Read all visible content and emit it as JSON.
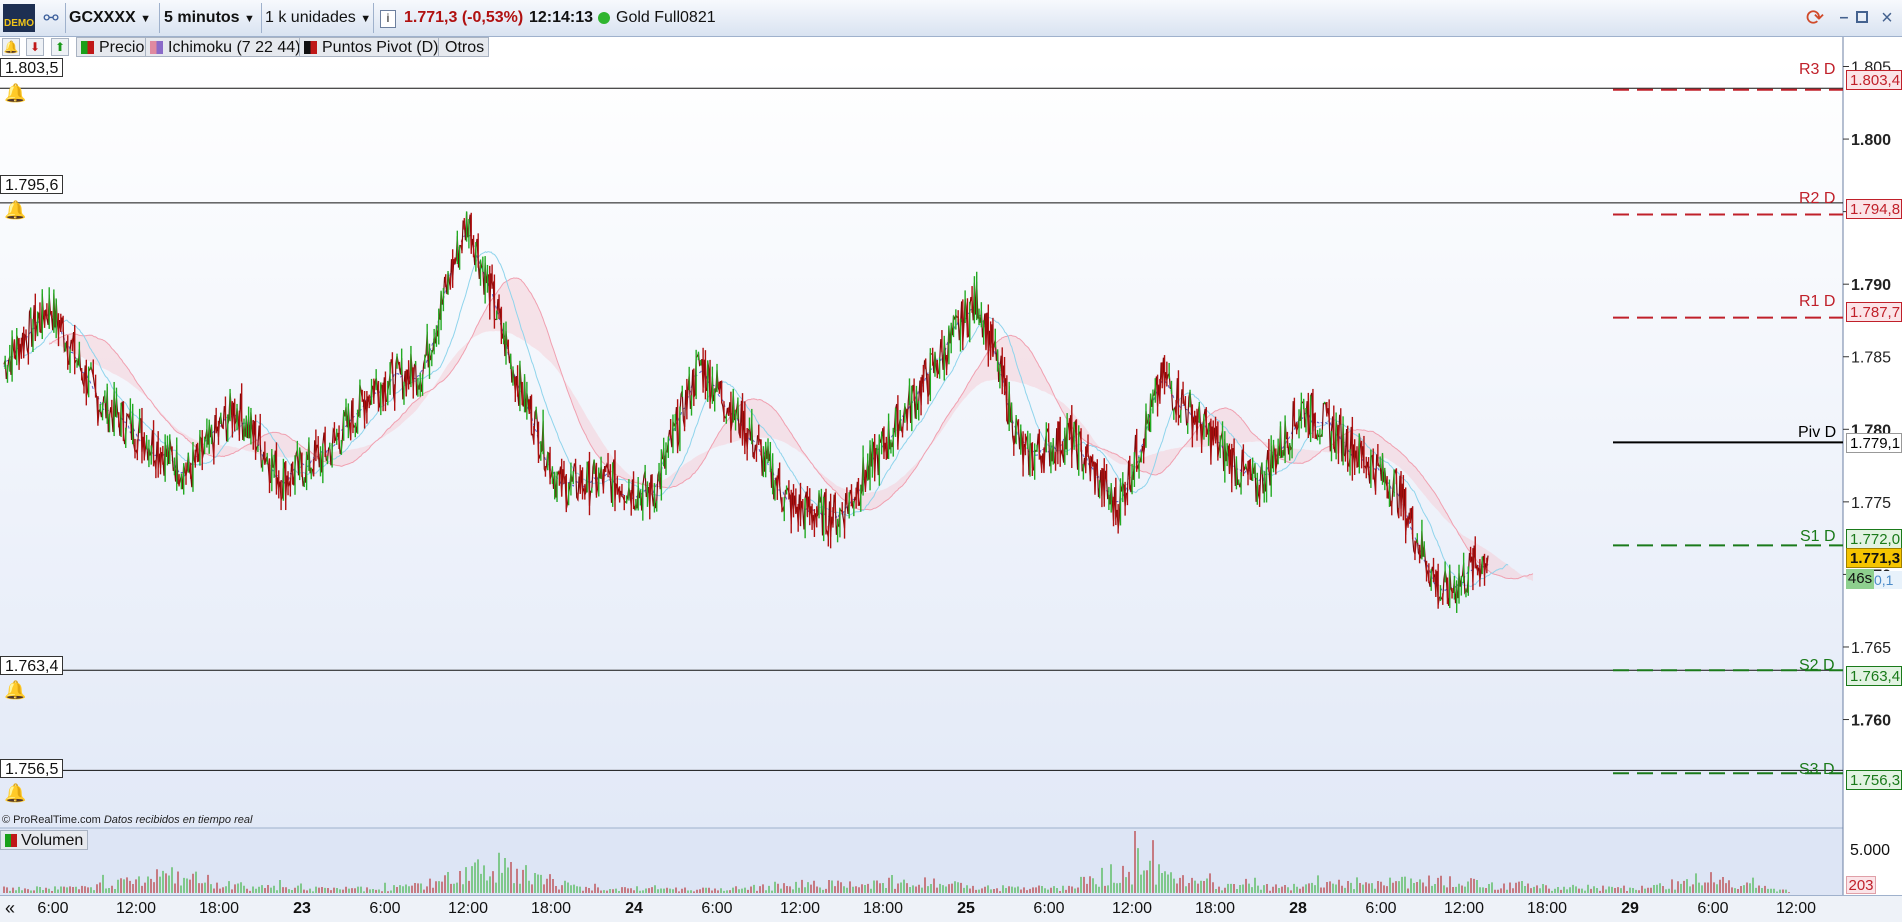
{
  "toolbar": {
    "demo_badge": "DEMO",
    "instrument": "GCXXXX",
    "timeframe": "5 minutos",
    "units": "1 k unidades",
    "price_change": "1.771,3 (-0,53%)",
    "time": "12:14:13",
    "contract": "Gold Full0821"
  },
  "subbar": {
    "pills": [
      "Precio",
      "Ichimoku (7 22 44)",
      "Puntos Pivot (D)",
      "Otros"
    ]
  },
  "alarm_levels": [
    "1.803,5",
    "1.795,6",
    "1.763,4",
    "1.756,5"
  ],
  "pivots": [
    {
      "label": "R3 D",
      "value": "1.803,4"
    },
    {
      "label": "R2 D",
      "value": "1.794,8"
    },
    {
      "label": "R1 D",
      "value": "1.787,7"
    },
    {
      "label": "Piv D",
      "value": "1.779,1"
    },
    {
      "label": "S1 D",
      "value": "1.772,0"
    },
    {
      "label": "S2 D",
      "value": "1.763,4"
    },
    {
      "label": "S3 D",
      "value": "1.756,3"
    }
  ],
  "last_price": "1.771,3",
  "countdown": "46s",
  "ichimoku_tag": "0,1",
  "price_axis_ticks": [
    "1.805",
    "1.800",
    "1.795",
    "1.790",
    "1.785",
    "1.780",
    "1.775",
    "1.770",
    "1.765",
    "1.760"
  ],
  "volume": {
    "label": "Volumen",
    "axis_tick": "5.000",
    "last_value": "203"
  },
  "footer": {
    "brand": "© ProRealTime.com",
    "note": "Datos recibidos en tiempo real"
  },
  "x_axis_ticks": [
    "6:00",
    "12:00",
    "18:00",
    "23",
    "6:00",
    "12:00",
    "18:00",
    "24",
    "6:00",
    "12:00",
    "18:00",
    "25",
    "6:00",
    "12:00",
    "18:00",
    "28",
    "6:00",
    "12:00",
    "18:00",
    "29",
    "6:00",
    "12:00"
  ],
  "colors": {
    "up": "#22aa22",
    "down": "#b01010",
    "resistance": "#c0202a",
    "support": "#1a7a1a",
    "pivot": "#000000",
    "last_price_bg": "#f5c400"
  },
  "chart_data": {
    "type": "line",
    "title": "GCXXXX",
    "y_unit": "price",
    "ylim": [
      1763,
      1806
    ],
    "x_categories": [
      "6:00",
      "12:00",
      "18:00",
      "23",
      "6:00",
      "12:00",
      "18:00",
      "24",
      "6:00",
      "12:00",
      "18:00",
      "25",
      "6:00",
      "12:00",
      "18:00",
      "28",
      "6:00",
      "12:00",
      "18:00",
      "29",
      "6:00",
      "12:00"
    ],
    "series": [
      {
        "name": "Precio",
        "points": [
          [
            0,
            1784.5
          ],
          [
            1,
            1788.5
          ],
          [
            2,
            1782.0
          ],
          [
            3,
            1779.5
          ],
          [
            4,
            1777.0
          ],
          [
            5,
            1781.5
          ],
          [
            6,
            1776.5
          ],
          [
            7,
            1778.5
          ],
          [
            8,
            1783.0
          ],
          [
            9,
            1784.0
          ],
          [
            10,
            1794.5
          ],
          [
            11,
            1784.0
          ],
          [
            12,
            1776.0
          ],
          [
            13,
            1776.5
          ],
          [
            14,
            1775.5
          ],
          [
            15,
            1784.5
          ],
          [
            16,
            1780.0
          ],
          [
            17,
            1774.5
          ],
          [
            18,
            1774.0
          ],
          [
            19,
            1779.0
          ],
          [
            20,
            1784.0
          ],
          [
            21,
            1789.0
          ],
          [
            22,
            1778.0
          ],
          [
            23,
            1779.5
          ],
          [
            24,
            1774.5
          ],
          [
            25,
            1783.5
          ],
          [
            26,
            1779.5
          ],
          [
            27,
            1776.0
          ],
          [
            28,
            1781.5
          ],
          [
            29,
            1779.0
          ],
          [
            30,
            1776.0
          ],
          [
            31,
            1768.5
          ],
          [
            32,
            1771.3
          ]
        ]
      }
    ],
    "volume_peaks": [
      [
        0,
        900
      ],
      [
        1,
        1200
      ],
      [
        2,
        4500
      ],
      [
        3,
        1500
      ],
      [
        4,
        900
      ],
      [
        5,
        1300
      ],
      [
        6,
        6200
      ],
      [
        7,
        1700
      ],
      [
        8,
        900
      ],
      [
        9,
        1100
      ],
      [
        10,
        2000
      ],
      [
        11,
        2900
      ],
      [
        12,
        1400
      ],
      [
        13,
        1100
      ],
      [
        14,
        6500
      ],
      [
        15,
        1600
      ],
      [
        16,
        1400
      ],
      [
        17,
        2800
      ],
      [
        18,
        2600
      ],
      [
        19,
        1500
      ],
      [
        20,
        1200
      ],
      [
        21,
        2900
      ],
      [
        22,
        400
      ]
    ]
  }
}
